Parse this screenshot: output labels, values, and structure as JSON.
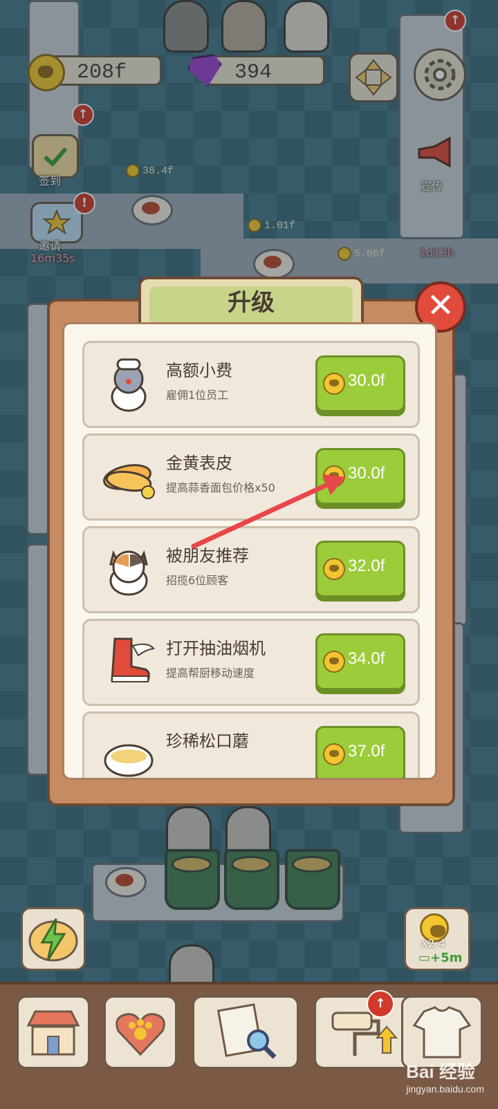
{
  "hud": {
    "coins": "208f",
    "gems": "394",
    "checkin_label": "签到",
    "invite_label": "邀请",
    "invite_timer": "16m35s",
    "promo_label": "宣传",
    "promo_timer": "1d13h"
  },
  "floor_coins": [
    "38.4f",
    "1.01f",
    "5.06f"
  ],
  "dialog": {
    "title": "升级",
    "close_label": "✕",
    "items": [
      {
        "title": "高额小费",
        "desc": "雇佣1位员工",
        "price": "30.0f",
        "icon": "chef-cat-icon"
      },
      {
        "title": "金黄表皮",
        "desc": "提高蒜香面包价格x50",
        "price": "30.0f",
        "icon": "bread-icon"
      },
      {
        "title": "被朋友推荐",
        "desc": "招揽6位顾客",
        "price": "32.0f",
        "icon": "calico-cat-icon"
      },
      {
        "title": "打开抽油烟机",
        "desc": "提高帮厨移动速度",
        "price": "34.0f",
        "icon": "winged-boot-icon"
      },
      {
        "title": "珍稀松口蘑",
        "desc": "",
        "price": "37.0f",
        "icon": "soup-bowl-icon"
      }
    ]
  },
  "boost": {
    "multiplier": "x2.4",
    "duration": "+5m"
  },
  "watermark": {
    "brand": "Bai 经验",
    "url": "jingyan.baidu.com"
  },
  "colors": {
    "price_button": "#9ccc3a",
    "close_button": "#e14b3b",
    "dialog_frame": "#c58b62",
    "annotation_arrow": "#e8474a"
  }
}
